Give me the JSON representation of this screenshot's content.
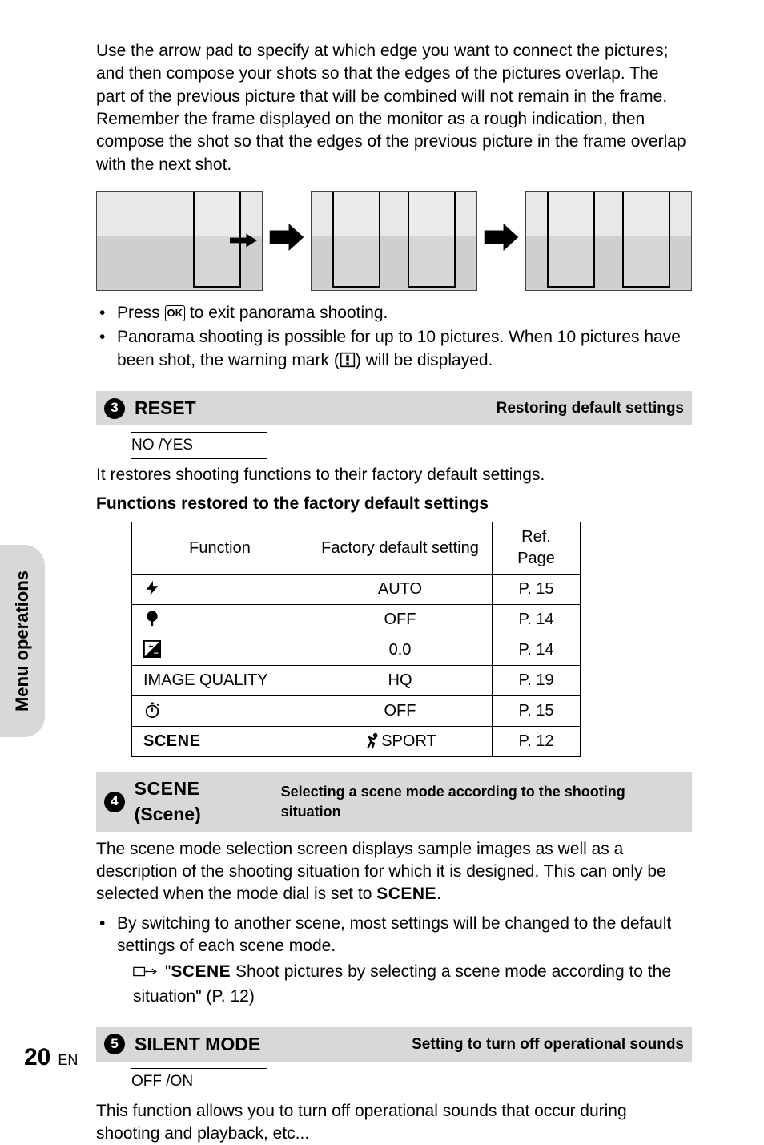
{
  "intro": "Use the arrow pad to specify at which edge you want to connect the pictures; and then compose your shots so that the edges of the pictures overlap. The part of the previous picture that will be combined will not remain in the frame.  Remember the frame displayed on the monitor as a rough indication, then compose the shot so that the edges of the previous picture in the frame overlap with the next shot.",
  "notes": {
    "n1a": "Press ",
    "n1b": " to exit panorama shooting.",
    "n2a": "Panorama shooting is possible for up to 10 pictures. When 10 pictures have been shot, the warning mark (",
    "n2b": ") will be displayed."
  },
  "ok_label": "OK",
  "sections": {
    "s3": {
      "num": "3",
      "title": "RESET",
      "sub": "Restoring default settings"
    },
    "s4": {
      "num": "4",
      "title_scene": "SCENE",
      "title_paren": " (Scene)",
      "sub": "Selecting a scene mode according to the shooting situation"
    },
    "s5": {
      "num": "5",
      "title": "SILENT MODE",
      "sub": "Setting to turn off operational sounds"
    }
  },
  "reset": {
    "opts": "NO   /YES",
    "desc": "It restores shooting functions to their factory default settings.",
    "subhead": "Functions restored to the factory default settings",
    "head": {
      "c1": "Function",
      "c2": "Factory default setting",
      "c3": "Ref. Page"
    },
    "rows": [
      {
        "fn_icon": "flash",
        "fn": "",
        "val": "AUTO",
        "ref": "P. 15"
      },
      {
        "fn_icon": "macro",
        "fn": "",
        "val": "OFF",
        "ref": "P. 14"
      },
      {
        "fn_icon": "exp",
        "fn": "",
        "val": "0.0",
        "ref": "P. 14"
      },
      {
        "fn_icon": "",
        "fn": "IMAGE QUALITY",
        "val": "HQ",
        "ref": "P. 19"
      },
      {
        "fn_icon": "timer",
        "fn": "",
        "val": "OFF",
        "ref": "P. 15"
      },
      {
        "fn_icon": "scene",
        "fn": "",
        "val_icon": "sport",
        "val": "SPORT",
        "ref": "P. 12"
      }
    ]
  },
  "scene": {
    "p1": "The scene mode selection screen displays sample images as well as a description of the shooting situation for which it is designed. This can only be selected when the mode dial is set to ",
    "scene_word": "SCENE",
    "p1b": ".",
    "b1": "By switching to another scene, most settings will be changed to the default settings of each scene mode.",
    "ref_pre": "\"",
    "ref_scene": "SCENE",
    "ref_txt": " Shoot pictures by selecting a scene mode according to the situation\" (P. 12)"
  },
  "silent": {
    "opts": "OFF  /ON",
    "desc": "This function allows you to turn off operational sounds that occur during shooting and playback, etc..."
  },
  "sidetab": "Menu operations",
  "page": {
    "num": "20",
    "lang": "EN"
  }
}
